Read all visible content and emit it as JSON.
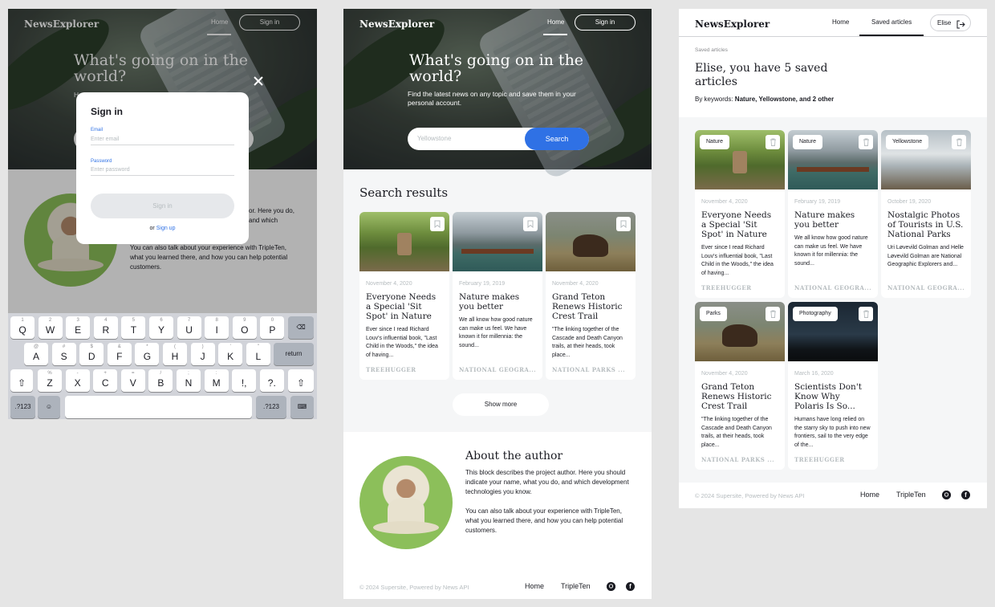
{
  "brand": "NewsExplorer",
  "nav": {
    "home": "Home",
    "signin": "Sign in",
    "saved": "Saved articles",
    "user": "Elise"
  },
  "hero": {
    "title": "What's going on in the world?",
    "subtitle": "Find the latest news on any topic and save them in your personal account.",
    "search_placeholder": "Yellowstone",
    "search_button": "Search"
  },
  "modal": {
    "title": "Sign in",
    "email_label": "Email",
    "email_placeholder": "Enter email",
    "password_label": "Password",
    "password_placeholder": "Enter password",
    "submit": "Sign in",
    "or": "or",
    "signup": "Sign up"
  },
  "keyboard": {
    "row1": [
      [
        "1",
        "Q"
      ],
      [
        "2",
        "W"
      ],
      [
        "3",
        "E"
      ],
      [
        "4",
        "R"
      ],
      [
        "5",
        "T"
      ],
      [
        "6",
        "Y"
      ],
      [
        "7",
        "U"
      ],
      [
        "8",
        "I"
      ],
      [
        "9",
        "O"
      ],
      [
        "0",
        "P"
      ]
    ],
    "row2": [
      [
        "@",
        "A"
      ],
      [
        "#",
        "S"
      ],
      [
        "$",
        "D"
      ],
      [
        "&",
        "F"
      ],
      [
        "*",
        "G"
      ],
      [
        "(",
        "H"
      ],
      [
        ")",
        "J"
      ],
      [
        "'",
        "K"
      ],
      [
        "\"",
        "L"
      ]
    ],
    "row3": [
      [
        "%",
        "Z"
      ],
      [
        "-",
        "X"
      ],
      [
        "+",
        "C"
      ],
      [
        "=",
        "V"
      ],
      [
        "/",
        "B"
      ],
      [
        ";",
        "N"
      ],
      [
        ":",
        "M"
      ],
      [
        "",
        "!,"
      ],
      [
        "",
        "?."
      ]
    ],
    "return": "return",
    "num": ".?123"
  },
  "results": {
    "title": "Search results",
    "show_more": "Show more",
    "cards": [
      {
        "date": "November 4, 2020",
        "title": "Everyone Needs a Special 'Sit Spot' in Nature",
        "text": "Ever since I read Richard Louv's influential book, \"Last Child in the Woods,\" the idea of having...",
        "source": "TREEHUGGER",
        "img": "forest"
      },
      {
        "date": "February 19, 2019",
        "title": "Nature makes you better",
        "text": "We all know how good nature can make us feel. We have known it for millennia: the sound...",
        "source": "NATIONAL GEOGRA...",
        "img": "lake"
      },
      {
        "date": "November 4, 2020",
        "title": "Grand Teton Renews Historic Crest Trail",
        "text": "\"The linking together of the Cascade and Death Canyon trails, at their heads, took place...",
        "source": "NATIONAL PARKS ...",
        "img": "moose"
      }
    ]
  },
  "about": {
    "title": "About the author",
    "p1": "This block describes the project author. Here you should indicate your name, what you do, and which development technologies you know.",
    "p2": "You can also talk about your experience with TripleTen, what you learned there, and how you can help potential customers.",
    "p1_partial": "or. Here you do, and which",
    "p2_modal": "You can also talk about your experience with TripleTen, what you learned there, and how you can help potential customers."
  },
  "footer": {
    "copy": "© 2024 Supersite, Powered by News API",
    "home": "Home",
    "tripleten": "TripleTen"
  },
  "saved": {
    "label": "Saved articles",
    "heading": "Elise, you have 5 saved articles",
    "keywords_prefix": "By keywords: ",
    "keywords": "Nature, Yellowstone, and 2 other",
    "cards": [
      {
        "tag": "Nature",
        "date": "November 4, 2020",
        "title": "Everyone Needs a Special 'Sit Spot' in Nature",
        "text": "Ever since I read Richard Louv's influential book, \"Last Child in the Woods,\" the idea of having...",
        "source": "TREEHUGGER",
        "img": "forest"
      },
      {
        "tag": "Nature",
        "date": "February 19, 2019",
        "title": "Nature makes you better",
        "text": "We all know how good nature can make us feel. We have known it for millennia: the sound...",
        "source": "NATIONAL GEOGRA...",
        "img": "lake"
      },
      {
        "tag": "Yellowstone",
        "date": "October 19, 2020",
        "title": "Nostalgic Photos of Tourists in U.S. National Parks",
        "text": "Uri Løvevild Golman and Helle Løvevild Golman are National Geographic Explorers and...",
        "source": "NATIONAL GEOGRA...",
        "img": "geyser"
      },
      {
        "tag": "Parks",
        "date": "November 4, 2020",
        "title": "Grand Teton Renews Historic Crest Trail",
        "text": "\"The linking together of the Cascade and Death Canyon trails, at their heads, took place...",
        "source": "NATIONAL PARKS ...",
        "img": "moose"
      },
      {
        "tag": "Photography",
        "date": "March 16, 2020",
        "title": "Scientists Don't Know Why Polaris Is So...",
        "text": "Humans have long relied on the starry sky to push into new frontiers, sail to the very edge of the...",
        "source": "TREEHUGGER",
        "img": "night"
      }
    ]
  }
}
